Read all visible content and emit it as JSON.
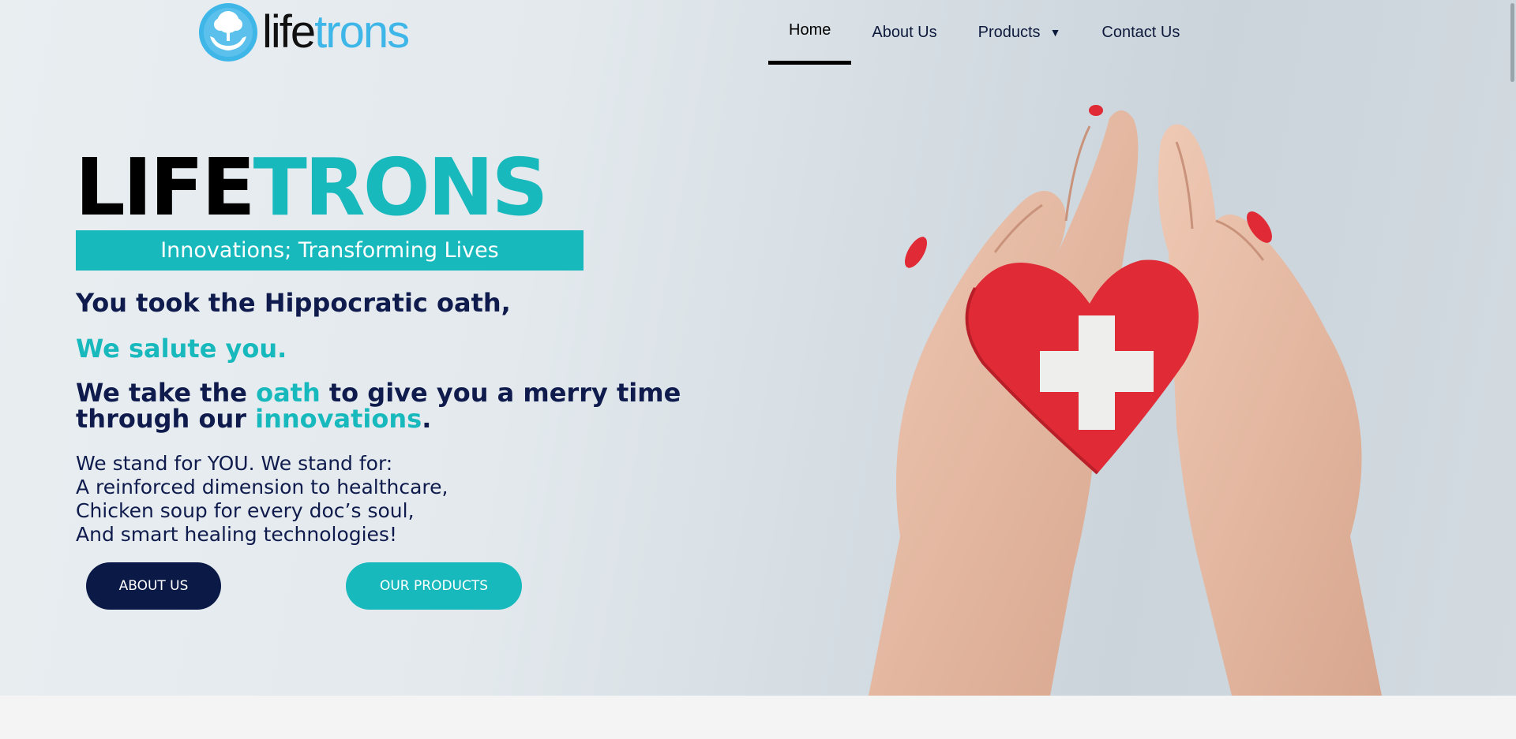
{
  "header": {
    "logo": {
      "part1": "life",
      "part2": "trons"
    },
    "nav": [
      {
        "label": "Home"
      },
      {
        "label": "About Us"
      },
      {
        "label": "Products"
      },
      {
        "label": "Contact Us"
      }
    ]
  },
  "hero": {
    "title_part1": "LIFE",
    "title_part2": "TRONS",
    "tagline": "Innovations; Transforming Lives",
    "line1": "You took the Hippocratic oath,",
    "line2": "We salute you.",
    "line3": {
      "t1": "We take the ",
      "t2": "oath",
      "t3": " to give you a merry time through our ",
      "t4": "innovations",
      "t5": "."
    },
    "paragraph": [
      "We stand for YOU. We stand for:",
      "A reinforced dimension to healthcare,",
      "Chicken soup for every doc’s soul,",
      "And smart healing technologies!"
    ],
    "buttons": {
      "about": "ABOUT US",
      "products": "OUR PRODUCTS"
    }
  },
  "colors": {
    "teal": "#18b9bd",
    "navy": "#0b1947",
    "logo_blue": "#3fb6e8",
    "heart_red": "#e02a35"
  },
  "icons": [
    "tree-hands-logo-icon",
    "caret-down-icon"
  ]
}
